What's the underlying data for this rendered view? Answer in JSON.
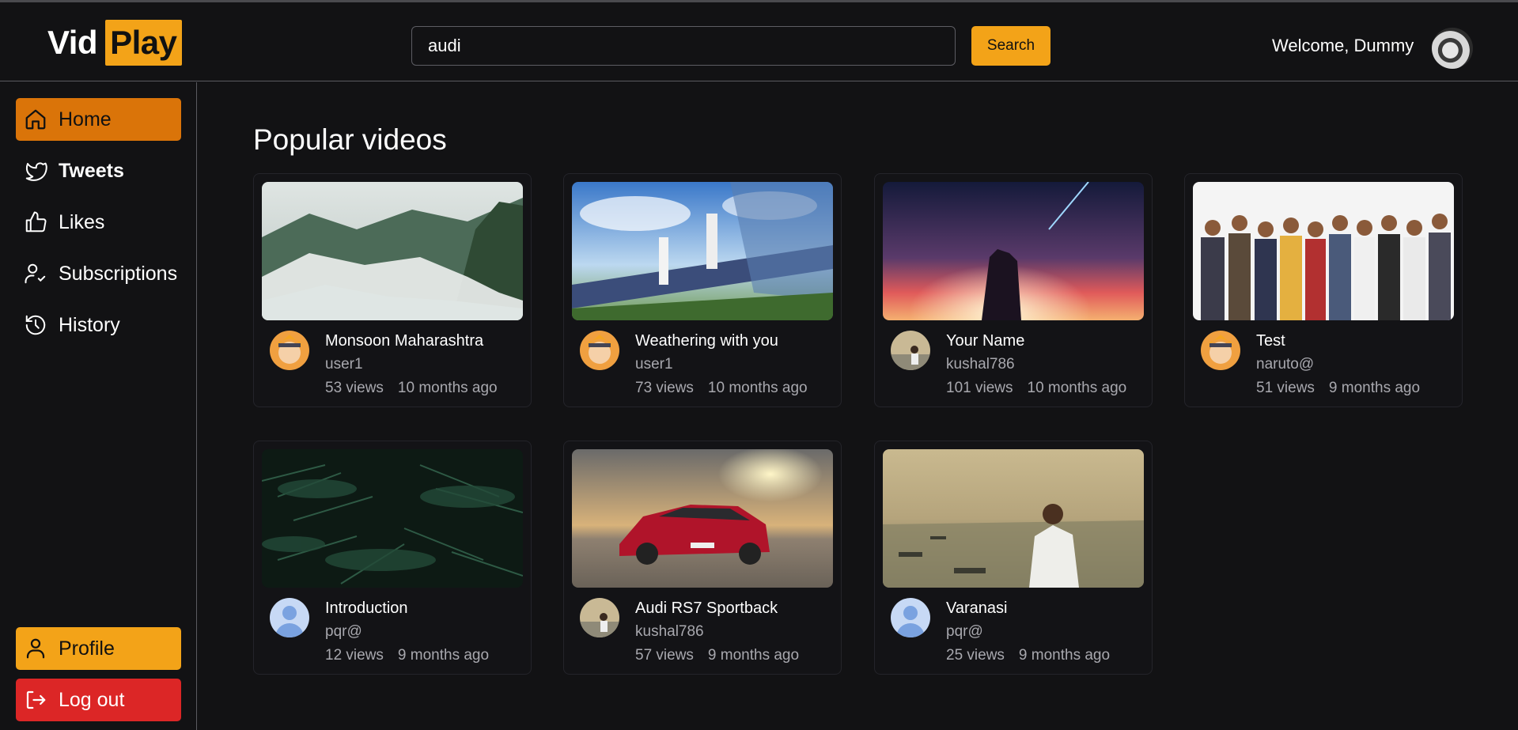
{
  "app": {
    "logo_part1": "Vid",
    "logo_part2": "Play",
    "accent": "#f3a318"
  },
  "header": {
    "search_value": "audi",
    "search_button": "Search",
    "welcome": "Welcome, Dummy",
    "avatar_icon": "user-avatar-icon"
  },
  "sidebar": {
    "items": [
      {
        "label": "Home",
        "icon": "home-icon",
        "active": true
      },
      {
        "label": "Tweets",
        "icon": "twitter-bird-icon"
      },
      {
        "label": "Likes",
        "icon": "thumbs-up-icon"
      },
      {
        "label": "Subscriptions",
        "icon": "user-check-icon"
      },
      {
        "label": "History",
        "icon": "history-icon"
      }
    ],
    "profile_label": "Profile",
    "logout_label": "Log out"
  },
  "main": {
    "title": "Popular videos",
    "videos": [
      {
        "title": "Monsoon Maharashtra",
        "channel": "user1",
        "views": "53 views",
        "age": "10 months ago"
      },
      {
        "title": "Weathering with you",
        "channel": "user1",
        "views": "73 views",
        "age": "10 months ago"
      },
      {
        "title": "Your Name",
        "channel": "kushal786",
        "views": "101 views",
        "age": "10 months ago"
      },
      {
        "title": "Test",
        "channel": "naruto@",
        "views": "51 views",
        "age": "9 months ago"
      },
      {
        "title": "Introduction",
        "channel": "pqr@",
        "views": "12 views",
        "age": "9 months ago"
      },
      {
        "title": "Audi RS7 Sportback",
        "channel": "kushal786",
        "views": "57 views",
        "age": "9 months ago"
      },
      {
        "title": "Varanasi",
        "channel": "pqr@",
        "views": "25 views",
        "age": "9 months ago"
      }
    ]
  }
}
